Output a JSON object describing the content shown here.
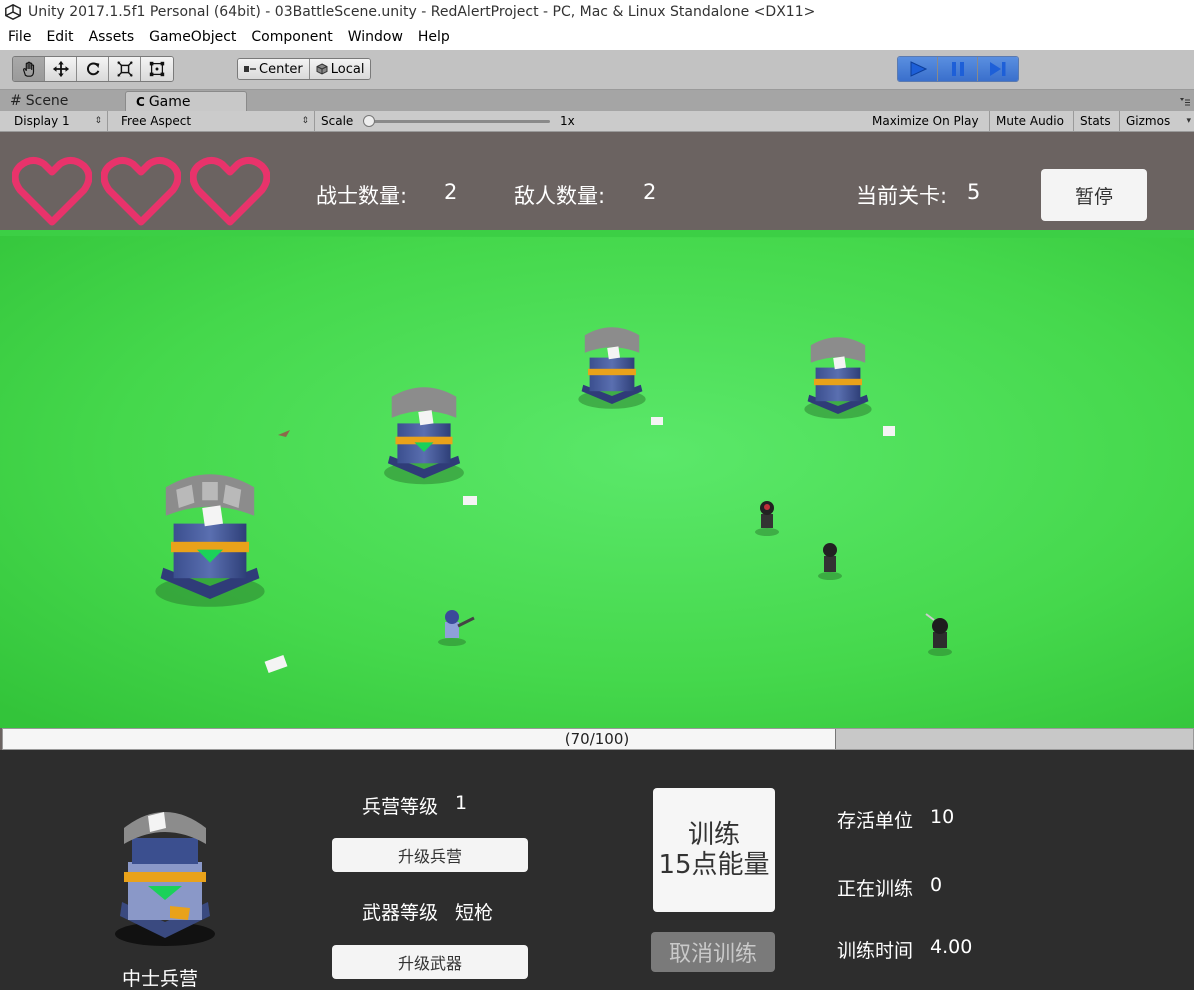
{
  "window": {
    "title": "Unity 2017.1.5f1 Personal (64bit) - 03BattleScene.unity - RedAlertProject - PC, Mac & Linux Standalone <DX11>"
  },
  "menu": [
    "File",
    "Edit",
    "Assets",
    "GameObject",
    "Component",
    "Window",
    "Help"
  ],
  "toolbar": {
    "tools": [
      "hand-tool",
      "move-tool",
      "rotate-tool",
      "scale-tool",
      "rect-tool"
    ],
    "pivot_mode": "Center",
    "pivot_rotation": "Local",
    "play_state": "playing"
  },
  "tabs": [
    {
      "label": "Scene",
      "active": false
    },
    {
      "label": "Game",
      "active": true
    }
  ],
  "gamebar": {
    "display": "Display 1",
    "aspect": "Free Aspect",
    "scale_label": "Scale",
    "scale_value": "1x",
    "maximize": "Maximize On Play",
    "mute": "Mute Audio",
    "stats": "Stats",
    "gizmos": "Gizmos"
  },
  "hud": {
    "lives": 3,
    "soldier_label": "战士数量:",
    "soldier_count": "2",
    "enemy_label": "敌人数量:",
    "enemy_count": "2",
    "level_label": "当前关卡:",
    "level_value": "5",
    "pause_label": "暂停",
    "heart_color": "#e8336b"
  },
  "energy": {
    "text": "(70/100)",
    "current": 70,
    "max": 100
  },
  "panel": {
    "barracks_name": "中士兵营",
    "barracks_level_label": "兵营等级",
    "barracks_level": "1",
    "upgrade_barracks": "升级兵营",
    "weapon_level_label": "武器等级",
    "weapon_level": "短枪",
    "upgrade_weapon": "升级武器",
    "train_line1": "训练",
    "train_line2": "15点能量",
    "cancel_train": "取消训练",
    "alive_label": "存活单位",
    "alive_value": "10",
    "training_label": "正在训练",
    "training_value": "0",
    "train_time_label": "训练时间",
    "train_time_value": "4.00"
  }
}
